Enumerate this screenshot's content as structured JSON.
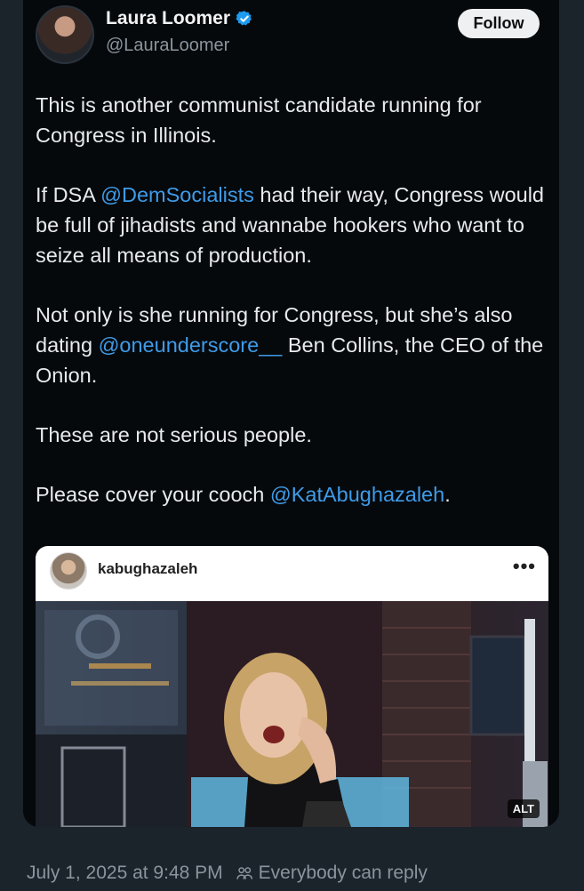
{
  "post": {
    "author": {
      "name": "Laura Loomer",
      "handle": "@LauraLoomer",
      "verified": true
    },
    "follow_label": "Follow",
    "paragraphs": [
      [
        {
          "text": "This is another communist candidate running for Congress in Illinois."
        }
      ],
      [
        {
          "text": "If DSA "
        },
        {
          "text": "@DemSocialists",
          "mention": true
        },
        {
          "text": " had their way, Congress would be full of jihadists and wannabe hookers who want to seize all means of production."
        }
      ],
      [
        {
          "text": "Not only is she running for Congress, but she’s also dating "
        },
        {
          "text": "@oneunderscore__",
          "mention": true
        },
        {
          "text": " Ben Collins, the CEO of the Onion."
        }
      ],
      [
        {
          "text": "These are not serious people."
        }
      ],
      [
        {
          "text": "Please cover your cooch "
        },
        {
          "text": "@KatAbughazaleh",
          "mention": true
        },
        {
          "text": "."
        }
      ]
    ],
    "media": {
      "embedded_username": "kabughazaleh",
      "more_icon": "•••",
      "alt_badge": "ALT"
    },
    "timestamp": "July 1, 2025 at 9:48 PM",
    "reply_setting": "Everybody can reply"
  },
  "colors": {
    "background": "#1b232b",
    "card": "#06090c",
    "mention": "#3f9be8",
    "verified": "#1d9bf0",
    "follow_button": "#eef0f2"
  },
  "icons": {
    "verified": "verified-badge-icon",
    "people": "people-icon",
    "more": "more-options-icon"
  }
}
